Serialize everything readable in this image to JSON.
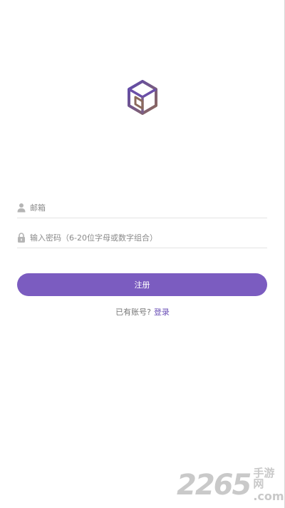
{
  "form": {
    "email_placeholder": "邮箱",
    "password_placeholder": "输入密码（6-20位字母或数字组合）",
    "register_label": "注册"
  },
  "footer": {
    "have_account_text": "已有账号?",
    "login_link": "登录"
  },
  "watermark": {
    "number": "2265",
    "site_name": "手游网",
    "domain": ".com"
  },
  "icons": {
    "logo": "cube-logo-icon",
    "email": "user-icon",
    "password": "lock-icon"
  },
  "colors": {
    "accent": "#7b5cc0",
    "link": "#6a4fb6",
    "logo_purple": "#6b4fa8",
    "logo_brown": "#8b6a5c"
  }
}
